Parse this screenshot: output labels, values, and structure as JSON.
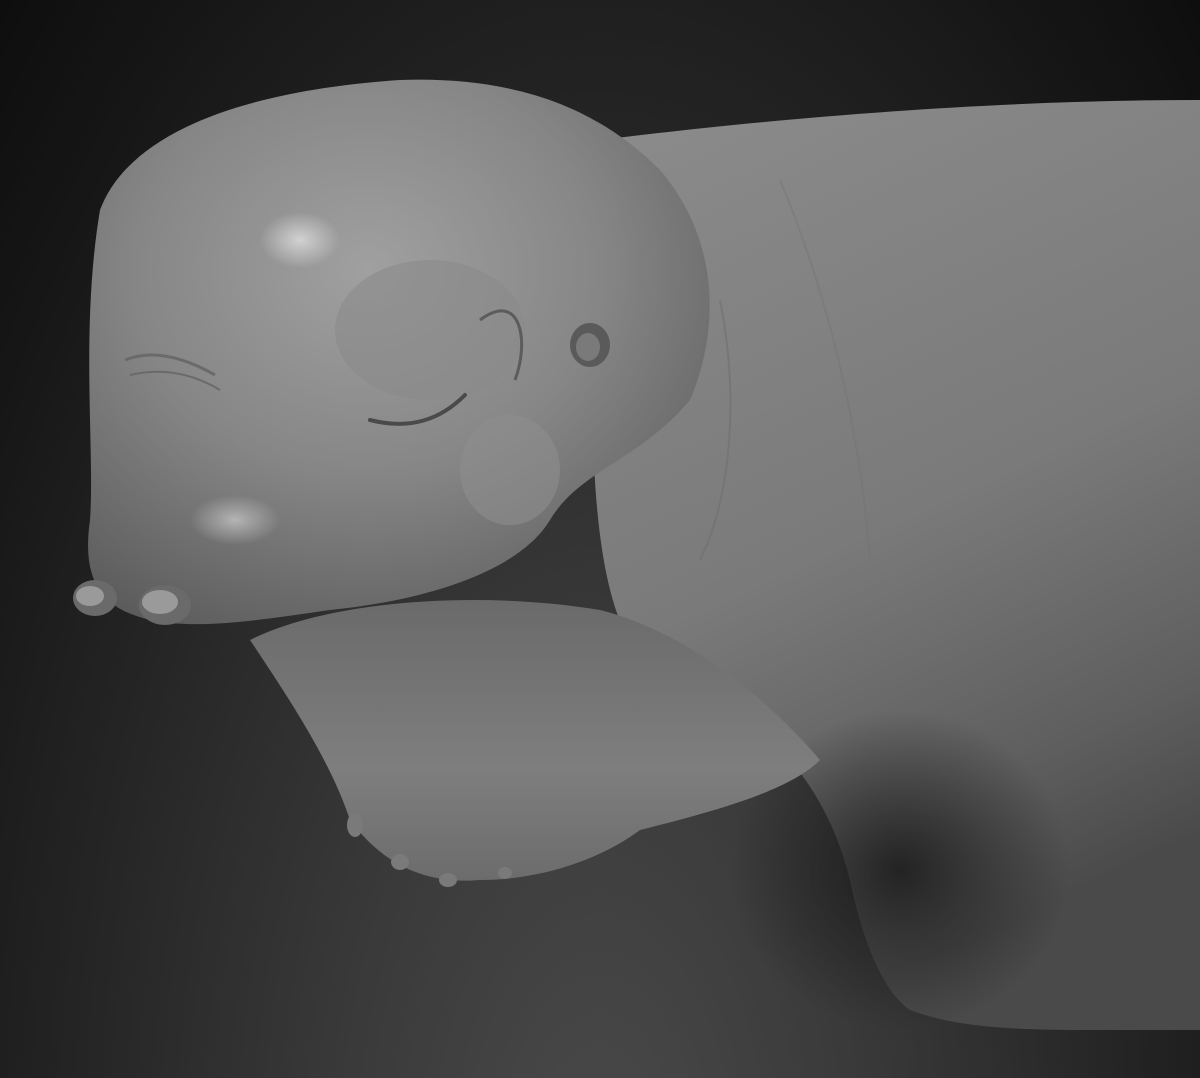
{
  "app": {
    "title": ""
  },
  "viewport": {
    "background_top": "#111111",
    "background_bottom": "#4a4a4a",
    "model_color": "#8a8a8a",
    "shade_color": "#3a3a3a"
  }
}
